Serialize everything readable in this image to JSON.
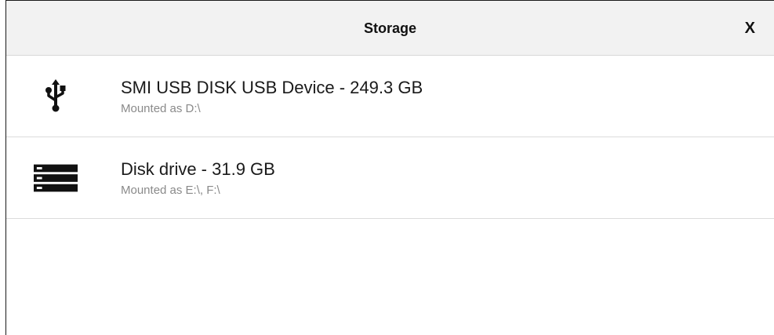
{
  "dialog": {
    "title": "Storage",
    "close_label": "X"
  },
  "devices": [
    {
      "name": "SMI USB DISK USB Device - 249.3 GB",
      "mount": "Mounted as D:\\",
      "icon": "usb-icon"
    },
    {
      "name": "Disk drive - 31.9 GB",
      "mount": "Mounted as E:\\, F:\\",
      "icon": "disk-drive-icon"
    }
  ]
}
